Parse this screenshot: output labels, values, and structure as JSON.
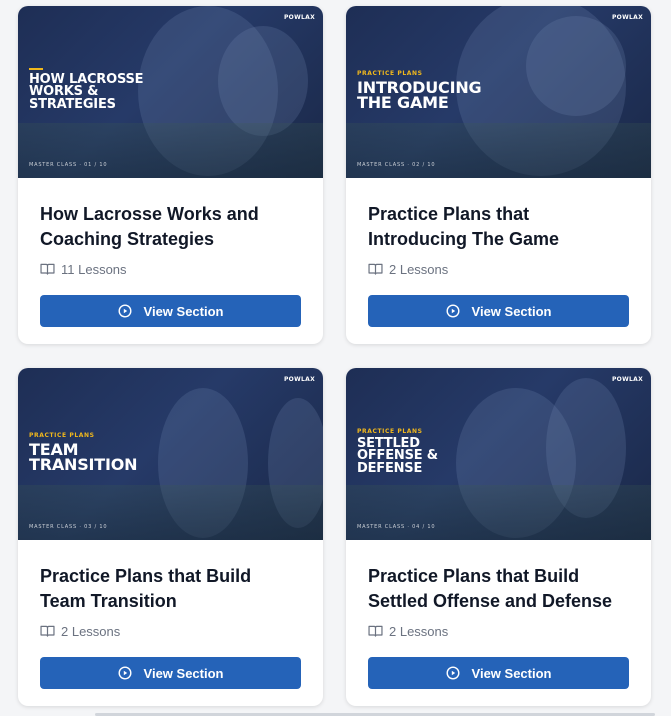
{
  "brand": "POWLAX",
  "cards": [
    {
      "thumb_kicker": "",
      "thumb_lines": [
        "How Lacrosse",
        "Works &",
        "Strategies"
      ],
      "thumb_footer": "MASTER CLASS · 01 / 10",
      "title": "How Lacrosse Works and Coaching Strategies",
      "lessons": "11 Lessons",
      "button": "View Section"
    },
    {
      "thumb_kicker": "PRACTICE PLANS",
      "thumb_lines": [
        "Introducing",
        "The Game"
      ],
      "thumb_footer": "MASTER CLASS · 02 / 10",
      "title": "Practice Plans that Introducing The Game",
      "lessons": "2 Lessons",
      "button": "View Section"
    },
    {
      "thumb_kicker": "PRACTICE PLANS",
      "thumb_lines": [
        "Team",
        "Transition"
      ],
      "thumb_footer": "MASTER CLASS · 03 / 10",
      "title": "Practice Plans that Build Team Transition",
      "lessons": "2 Lessons",
      "button": "View Section"
    },
    {
      "thumb_kicker": "PRACTICE PLANS",
      "thumb_lines": [
        "Settled",
        "Offense &",
        "Defense"
      ],
      "thumb_footer": "MASTER CLASS · 04 / 10",
      "title": "Practice Plans that Build Settled Offense and Defense",
      "lessons": "2 Lessons",
      "button": "View Section"
    }
  ],
  "icons": {
    "lessons": "book-open-icon",
    "button": "play-circle-icon"
  },
  "colors": {
    "accent": "#2563b8",
    "thumb_bg": "#1e2e55",
    "kicker": "#f1b81c"
  }
}
